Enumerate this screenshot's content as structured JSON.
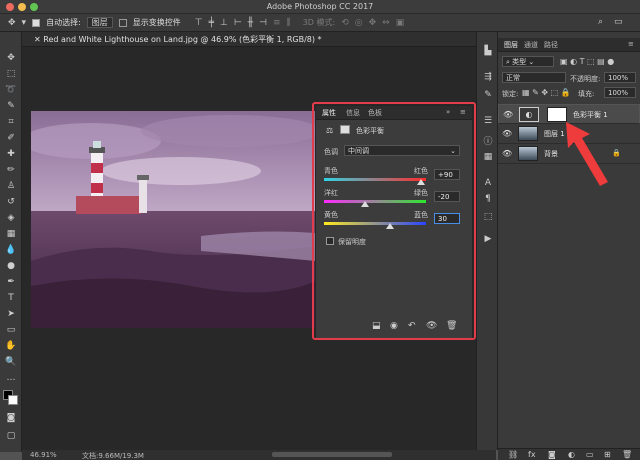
{
  "app": {
    "title": "Adobe Photoshop CC 2017"
  },
  "options_bar": {
    "move_icon": "✥",
    "auto_select_label": "自动选择:",
    "auto_select_value": "图层",
    "show_transform_label": "显示变换控件",
    "mode_3d_label": "3D 模式:"
  },
  "document": {
    "tab_title": "Red and White Lighthouse on Land.jpg @ 46.9% (色彩平衡 1, RGB/8) *",
    "zoom": "46.91%",
    "doc_size": "文档:9.66M/19.3M"
  },
  "properties": {
    "tabs": [
      "属性",
      "信息",
      "色板"
    ],
    "adjustment_title": "色彩平衡",
    "tone_label": "色调",
    "tone_value": "中间调",
    "sliders": [
      {
        "left": "青色",
        "right": "红色",
        "value": "+90",
        "position": 0.95
      },
      {
        "left": "洋红",
        "right": "绿色",
        "value": "-20",
        "position": 0.4
      },
      {
        "left": "黄色",
        "right": "蓝色",
        "value": "30",
        "position": 0.65
      }
    ],
    "preserve_luminosity_label": "保留明度",
    "preserve_luminosity_checked": false
  },
  "layers": {
    "tabs": [
      "图层",
      "通道",
      "路径"
    ],
    "filter_value": "类型",
    "blend_mode": "正常",
    "opacity_label": "不透明度:",
    "opacity_value": "100%",
    "lock_label": "锁定:",
    "fill_label": "填充:",
    "fill_value": "100%",
    "items": [
      {
        "name": "色彩平衡 1"
      },
      {
        "name": "图层 1"
      },
      {
        "name": "背景"
      }
    ]
  },
  "colors": {
    "highlight": "#e23b4b",
    "annotation_arrow": "#ee3b3b"
  }
}
